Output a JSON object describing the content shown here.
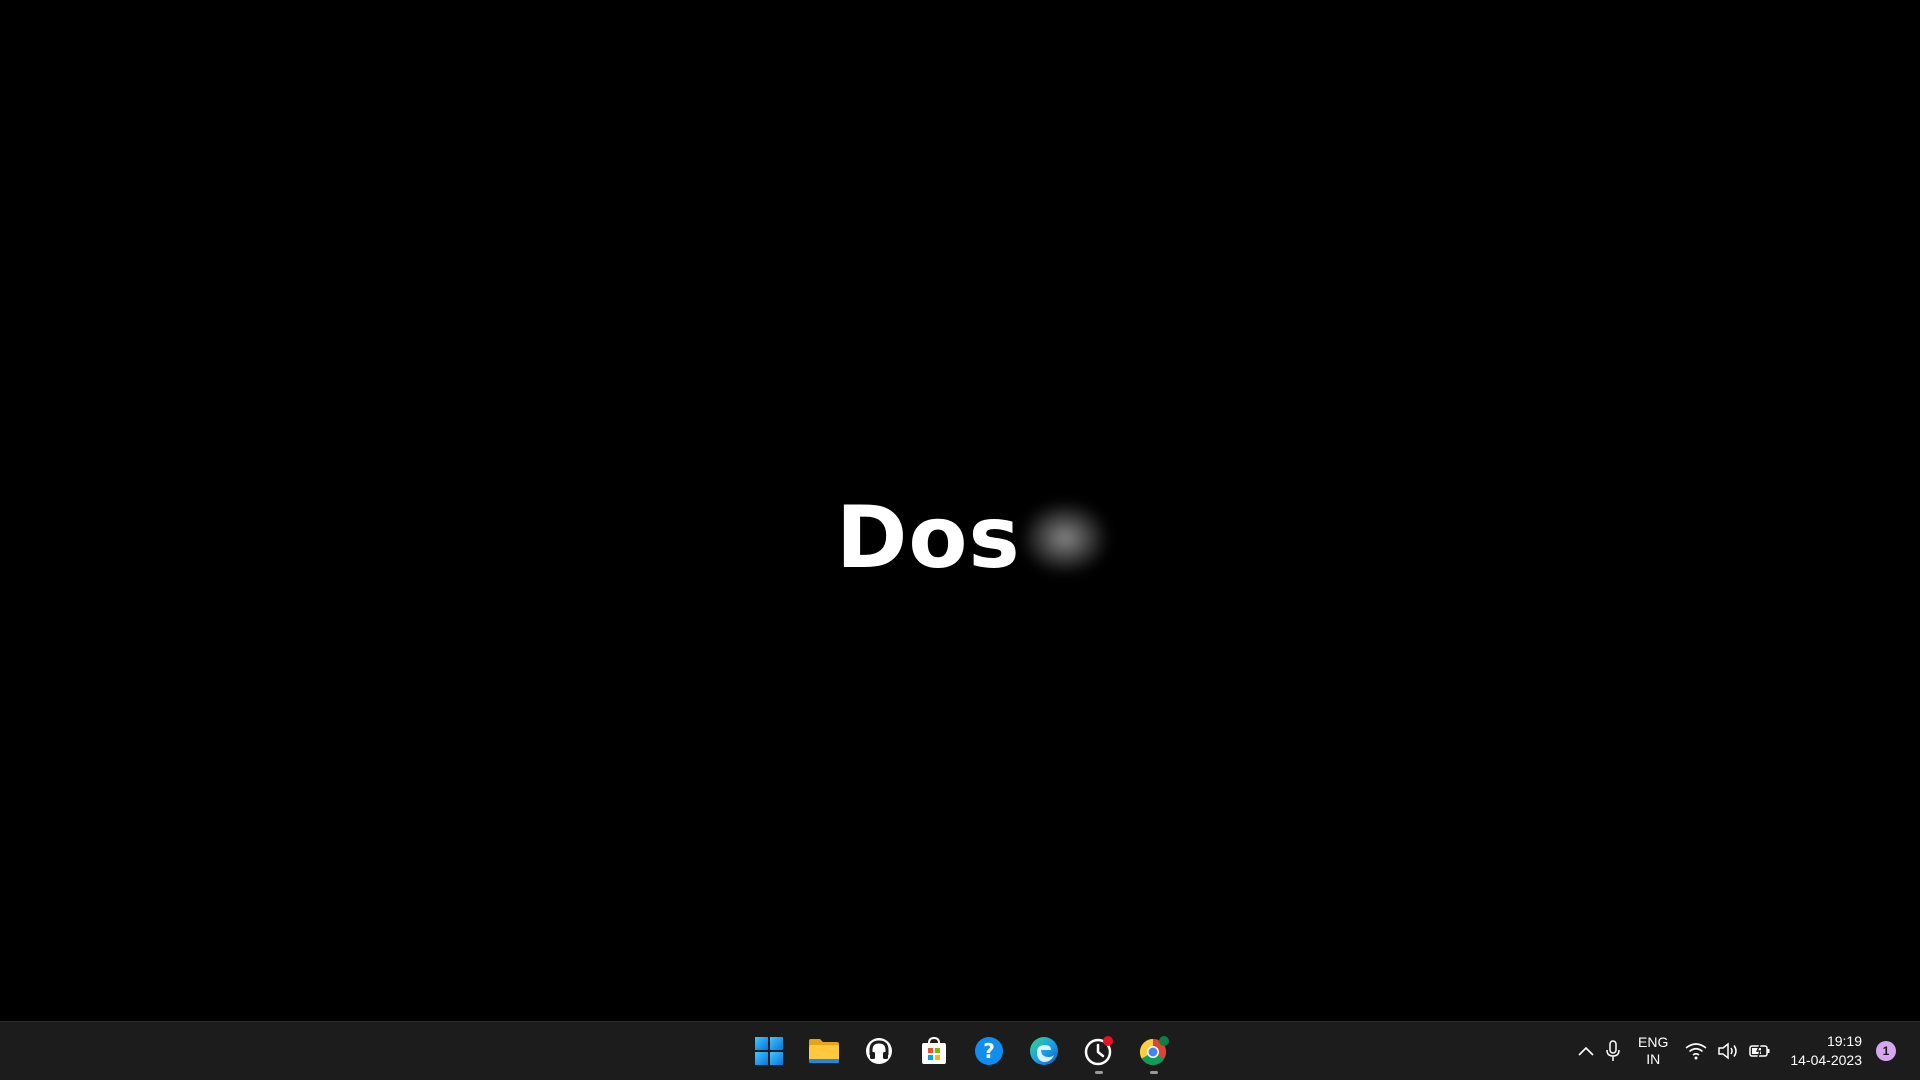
{
  "splash": {
    "visible_text": "Dos"
  },
  "taskbar": {
    "apps": [
      {
        "name": "start",
        "icon": "windows-logo-icon"
      },
      {
        "name": "file-explorer",
        "icon": "folder-icon"
      },
      {
        "name": "app-3",
        "icon": "headset-icon"
      },
      {
        "name": "microsoft-store",
        "icon": "store-icon"
      },
      {
        "name": "get-help",
        "icon": "help-icon"
      },
      {
        "name": "edge",
        "icon": "edge-icon"
      },
      {
        "name": "app-7",
        "icon": "clock-app-icon"
      },
      {
        "name": "chrome",
        "icon": "chrome-icon"
      }
    ],
    "tray": {
      "lang_line1": "ENG",
      "lang_line2": "IN",
      "time": "19:19",
      "date": "14-04-2023",
      "notification_count": "1"
    }
  },
  "colors": {
    "taskbar_bg": "#1c1c1c",
    "accent_blue": "#0f8ef0",
    "notification_badge": "#d6a6f0"
  }
}
